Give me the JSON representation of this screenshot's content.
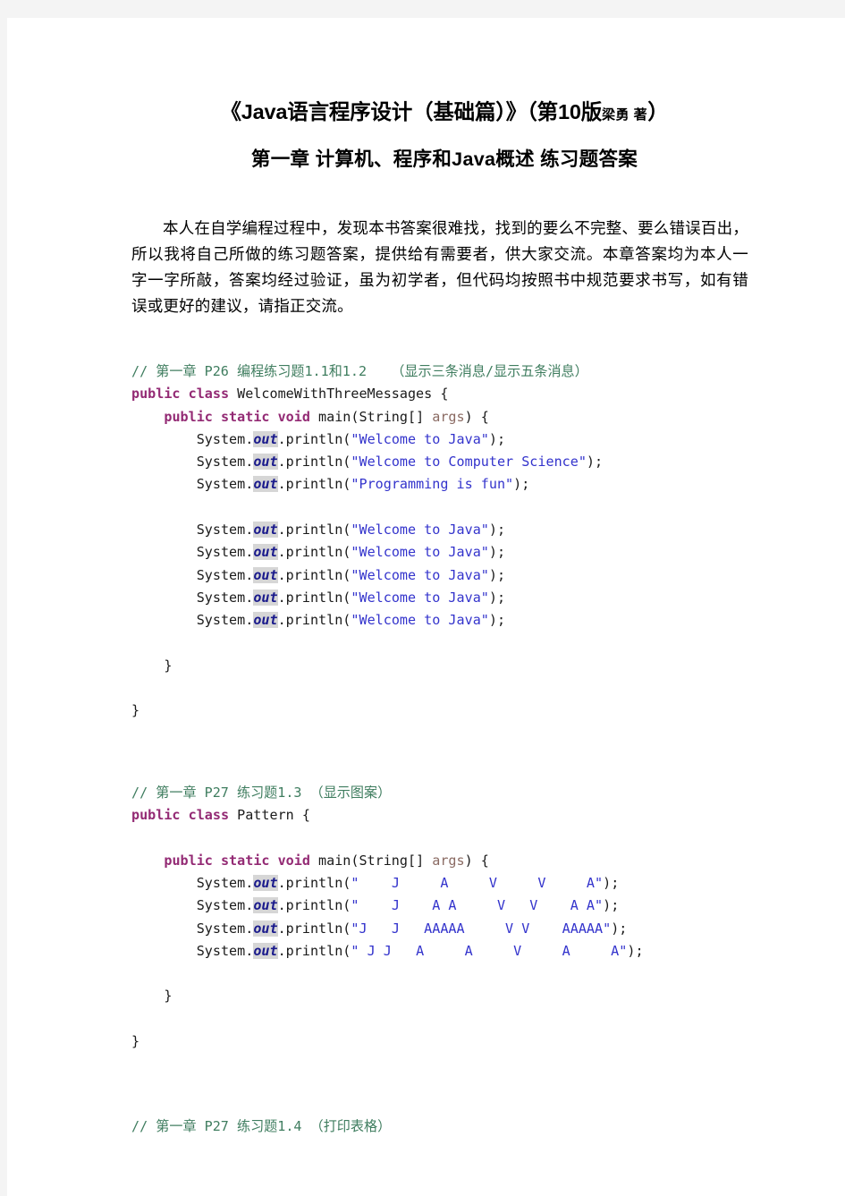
{
  "document": {
    "title_main_pre": "《Java语言程序设计（基础篇）》（第10版",
    "title_author": "梁勇 著",
    "title_main_post": "）",
    "title_sub": "第一章 计算机、程序和Java概述  练习题答案",
    "intro_paragraph": "本人在自学编程过程中，发现本书答案很难找，找到的要么不完整、要么错误百出，所以我将自己所做的练习题答案，提供给有需要者，供大家交流。本章答案均为本人一字一字所敲，答案均经过验证，虽为初学者，但代码均按照书中规范要求书写，如有错误或更好的建议，请指正交流。"
  },
  "colors": {
    "page_background": "#ffffff",
    "outer_background": "#f4f4f4",
    "comment": "#3f7d5f",
    "keyword": "#932a74",
    "string": "#3333cc",
    "param": "#8a6a62",
    "field_highlight_bg": "#d6d6d6",
    "field_text": "#1a1a8c",
    "body_text": "#1a1a1a"
  },
  "code_blocks": [
    {
      "id": "block-1",
      "comment": "// 第一章 P26 编程练习题1.1和1.2   （显示三条消息/显示五条消息）",
      "lines": [
        {
          "indent": 0,
          "segments": [
            {
              "t": "keyword",
              "v": "public class"
            },
            {
              "t": "plain",
              "v": " WelcomeWithThreeMessages {"
            }
          ]
        },
        {
          "indent": 1,
          "segments": [
            {
              "t": "keyword",
              "v": "public static void"
            },
            {
              "t": "plain",
              "v": " main(String[] "
            },
            {
              "t": "param",
              "v": "args"
            },
            {
              "t": "plain",
              "v": ") {"
            }
          ]
        },
        {
          "indent": 2,
          "segments": [
            {
              "t": "plain",
              "v": "System."
            },
            {
              "t": "field",
              "v": "out"
            },
            {
              "t": "plain",
              "v": ".println("
            },
            {
              "t": "string",
              "v": "\"Welcome to Java\""
            },
            {
              "t": "plain",
              "v": ");"
            }
          ]
        },
        {
          "indent": 2,
          "segments": [
            {
              "t": "plain",
              "v": "System."
            },
            {
              "t": "field",
              "v": "out"
            },
            {
              "t": "plain",
              "v": ".println("
            },
            {
              "t": "string",
              "v": "\"Welcome to Computer Science\""
            },
            {
              "t": "plain",
              "v": ");"
            }
          ]
        },
        {
          "indent": 2,
          "segments": [
            {
              "t": "plain",
              "v": "System."
            },
            {
              "t": "field",
              "v": "out"
            },
            {
              "t": "plain",
              "v": ".println("
            },
            {
              "t": "string",
              "v": "\"Programming is fun\""
            },
            {
              "t": "plain",
              "v": ");"
            }
          ]
        },
        {
          "indent": 0,
          "segments": []
        },
        {
          "indent": 2,
          "segments": [
            {
              "t": "plain",
              "v": "System."
            },
            {
              "t": "field",
              "v": "out"
            },
            {
              "t": "plain",
              "v": ".println("
            },
            {
              "t": "string",
              "v": "\"Welcome to Java\""
            },
            {
              "t": "plain",
              "v": ");"
            }
          ]
        },
        {
          "indent": 2,
          "segments": [
            {
              "t": "plain",
              "v": "System."
            },
            {
              "t": "field",
              "v": "out"
            },
            {
              "t": "plain",
              "v": ".println("
            },
            {
              "t": "string",
              "v": "\"Welcome to Java\""
            },
            {
              "t": "plain",
              "v": ");"
            }
          ]
        },
        {
          "indent": 2,
          "segments": [
            {
              "t": "plain",
              "v": "System."
            },
            {
              "t": "field",
              "v": "out"
            },
            {
              "t": "plain",
              "v": ".println("
            },
            {
              "t": "string",
              "v": "\"Welcome to Java\""
            },
            {
              "t": "plain",
              "v": ");"
            }
          ]
        },
        {
          "indent": 2,
          "segments": [
            {
              "t": "plain",
              "v": "System."
            },
            {
              "t": "field",
              "v": "out"
            },
            {
              "t": "plain",
              "v": ".println("
            },
            {
              "t": "string",
              "v": "\"Welcome to Java\""
            },
            {
              "t": "plain",
              "v": ");"
            }
          ]
        },
        {
          "indent": 2,
          "segments": [
            {
              "t": "plain",
              "v": "System."
            },
            {
              "t": "field",
              "v": "out"
            },
            {
              "t": "plain",
              "v": ".println("
            },
            {
              "t": "string",
              "v": "\"Welcome to Java\""
            },
            {
              "t": "plain",
              "v": ");"
            }
          ]
        },
        {
          "indent": 0,
          "segments": []
        },
        {
          "indent": 1,
          "segments": [
            {
              "t": "plain",
              "v": "}"
            }
          ]
        },
        {
          "indent": 0,
          "segments": []
        },
        {
          "indent": 0,
          "segments": [
            {
              "t": "plain",
              "v": "}"
            }
          ]
        }
      ]
    },
    {
      "id": "block-2",
      "comment": "// 第一章 P27 练习题1.3 （显示图案）",
      "lines": [
        {
          "indent": 0,
          "segments": [
            {
              "t": "keyword",
              "v": "public class"
            },
            {
              "t": "plain",
              "v": " Pattern {"
            }
          ]
        },
        {
          "indent": 0,
          "segments": []
        },
        {
          "indent": 1,
          "segments": [
            {
              "t": "keyword",
              "v": "public static void"
            },
            {
              "t": "plain",
              "v": " main(String[] "
            },
            {
              "t": "param",
              "v": "args"
            },
            {
              "t": "plain",
              "v": ") {"
            }
          ]
        },
        {
          "indent": 2,
          "segments": [
            {
              "t": "plain",
              "v": "System."
            },
            {
              "t": "field",
              "v": "out"
            },
            {
              "t": "plain",
              "v": ".println("
            },
            {
              "t": "string",
              "v": "\"    J     A     V     V     A\""
            },
            {
              "t": "plain",
              "v": ");"
            }
          ]
        },
        {
          "indent": 2,
          "segments": [
            {
              "t": "plain",
              "v": "System."
            },
            {
              "t": "field",
              "v": "out"
            },
            {
              "t": "plain",
              "v": ".println("
            },
            {
              "t": "string",
              "v": "\"    J    A A     V   V    A A\""
            },
            {
              "t": "plain",
              "v": ");"
            }
          ]
        },
        {
          "indent": 2,
          "segments": [
            {
              "t": "plain",
              "v": "System."
            },
            {
              "t": "field",
              "v": "out"
            },
            {
              "t": "plain",
              "v": ".println("
            },
            {
              "t": "string",
              "v": "\"J   J   AAAAA     V V    AAAAA\""
            },
            {
              "t": "plain",
              "v": ");"
            }
          ]
        },
        {
          "indent": 2,
          "segments": [
            {
              "t": "plain",
              "v": "System."
            },
            {
              "t": "field",
              "v": "out"
            },
            {
              "t": "plain",
              "v": ".println("
            },
            {
              "t": "string",
              "v": "\" J J   A     A     V     A     A\""
            },
            {
              "t": "plain",
              "v": ");"
            }
          ]
        },
        {
          "indent": 0,
          "segments": []
        },
        {
          "indent": 1,
          "segments": [
            {
              "t": "plain",
              "v": "}"
            }
          ]
        },
        {
          "indent": 0,
          "segments": []
        },
        {
          "indent": 0,
          "segments": [
            {
              "t": "plain",
              "v": "}"
            }
          ]
        }
      ]
    },
    {
      "id": "block-3",
      "comment": "// 第一章 P27 练习题1.4 （打印表格）",
      "lines": []
    }
  ]
}
